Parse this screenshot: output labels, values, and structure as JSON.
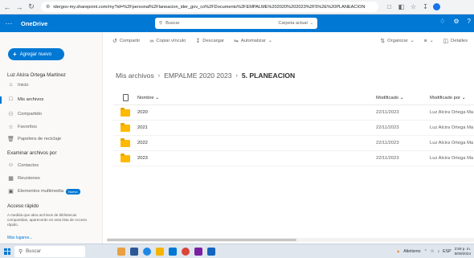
{
  "browser": {
    "url": "idergov-my.sharepoint.com/my?id=%2Fpersonal%2Flaneacion_ider_gov_co%2FDocuments%2FEMPALME%202020%202023%2F5%2E%20PLANEACION"
  },
  "header": {
    "brand": "OneDrive",
    "search_placeholder": "Buscar",
    "search_scope": "Carpeta actual"
  },
  "sidebar": {
    "add_button": "Agregar nuevo",
    "user_name": "Luz Alcira Ortega Martinez",
    "items": [
      {
        "label": "Inicio"
      },
      {
        "label": "Mis archivos"
      },
      {
        "label": "Compartido"
      },
      {
        "label": "Favoritos"
      },
      {
        "label": "Papelera de reciclaje"
      }
    ],
    "browse_header": "Examinar archivos por",
    "browse_items": [
      {
        "label": "Contactos"
      },
      {
        "label": "Reuniones"
      },
      {
        "label": "Elementos multimedia",
        "badge": "Nuevo"
      }
    ],
    "quick_access_header": "Acceso rápido",
    "quick_access_text": "A medida que abra archivos de bibliotecas compartidas, aparecerán en esta lista de Acceso rápido.",
    "more_places": "Más lugares..."
  },
  "commands": {
    "share": "Compartir",
    "copy_link": "Copiar vínculo",
    "download": "Descargar",
    "automate": "Automatizar",
    "organize": "Organizar",
    "details": "Detalles"
  },
  "breadcrumb": {
    "root": "Mis archivos",
    "parent": "EMPALME 2020 2023",
    "current": "5. PLANEACION"
  },
  "table": {
    "headers": {
      "name": "Nombre",
      "modified": "Modificado",
      "modified_by": "Modificado por"
    },
    "rows": [
      {
        "name": "2020",
        "modified": "22/11/2023",
        "modified_by": "Luz Alcira Ortega Ma"
      },
      {
        "name": "2021",
        "modified": "22/11/2023",
        "modified_by": "Luz Alcira Ortega Ma"
      },
      {
        "name": "2022",
        "modified": "22/11/2023",
        "modified_by": "Luz Alcira Ortega Ma"
      },
      {
        "name": "2023",
        "modified": "22/11/2023",
        "modified_by": "Luz Alcira Ortega Ma"
      }
    ]
  },
  "taskbar": {
    "search": "Buscar",
    "weather": "Atletismo",
    "lang": "ESP",
    "time": "2:59 p. m.",
    "date": "5/09/2024"
  }
}
